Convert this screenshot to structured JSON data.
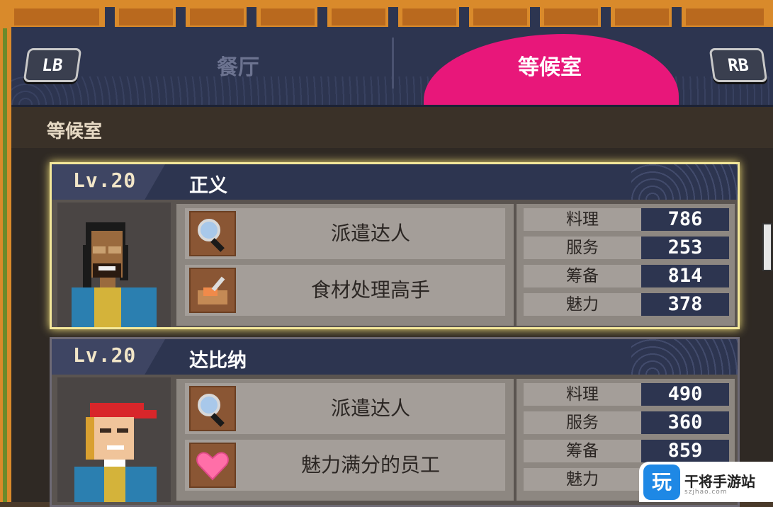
{
  "tabs": {
    "left_key": "LB",
    "right_key": "RB",
    "items": [
      {
        "label": "餐厅",
        "active": false
      },
      {
        "label": "等候室",
        "active": true
      }
    ]
  },
  "section": {
    "title": "等候室"
  },
  "staff": [
    {
      "level": "Lv.20",
      "name": "正义",
      "selected": true,
      "skills": [
        {
          "icon": "magnifier-icon",
          "label": "派遣达人"
        },
        {
          "icon": "cutting-board-icon",
          "label": "食材处理高手"
        }
      ],
      "stats": [
        {
          "label": "料理",
          "value": "786"
        },
        {
          "label": "服务",
          "value": "253"
        },
        {
          "label": "筹备",
          "value": "814"
        },
        {
          "label": "魅力",
          "value": "378"
        }
      ]
    },
    {
      "level": "Lv.20",
      "name": "达比纳",
      "selected": false,
      "skills": [
        {
          "icon": "magnifier-icon",
          "label": "派遣达人"
        },
        {
          "icon": "heart-icon",
          "label": "魅力满分的员工"
        }
      ],
      "stats": [
        {
          "label": "料理",
          "value": "490"
        },
        {
          "label": "服务",
          "value": "360"
        },
        {
          "label": "筹备",
          "value": "859"
        },
        {
          "label": "魅力",
          "value": ""
        }
      ]
    }
  ],
  "watermark": {
    "logo": "玩",
    "text": "干将手游站",
    "sub": "szjhao.com"
  },
  "colors": {
    "accent": "#e8177a",
    "header": "#2d3550",
    "selected_border": "#f3e79a"
  }
}
